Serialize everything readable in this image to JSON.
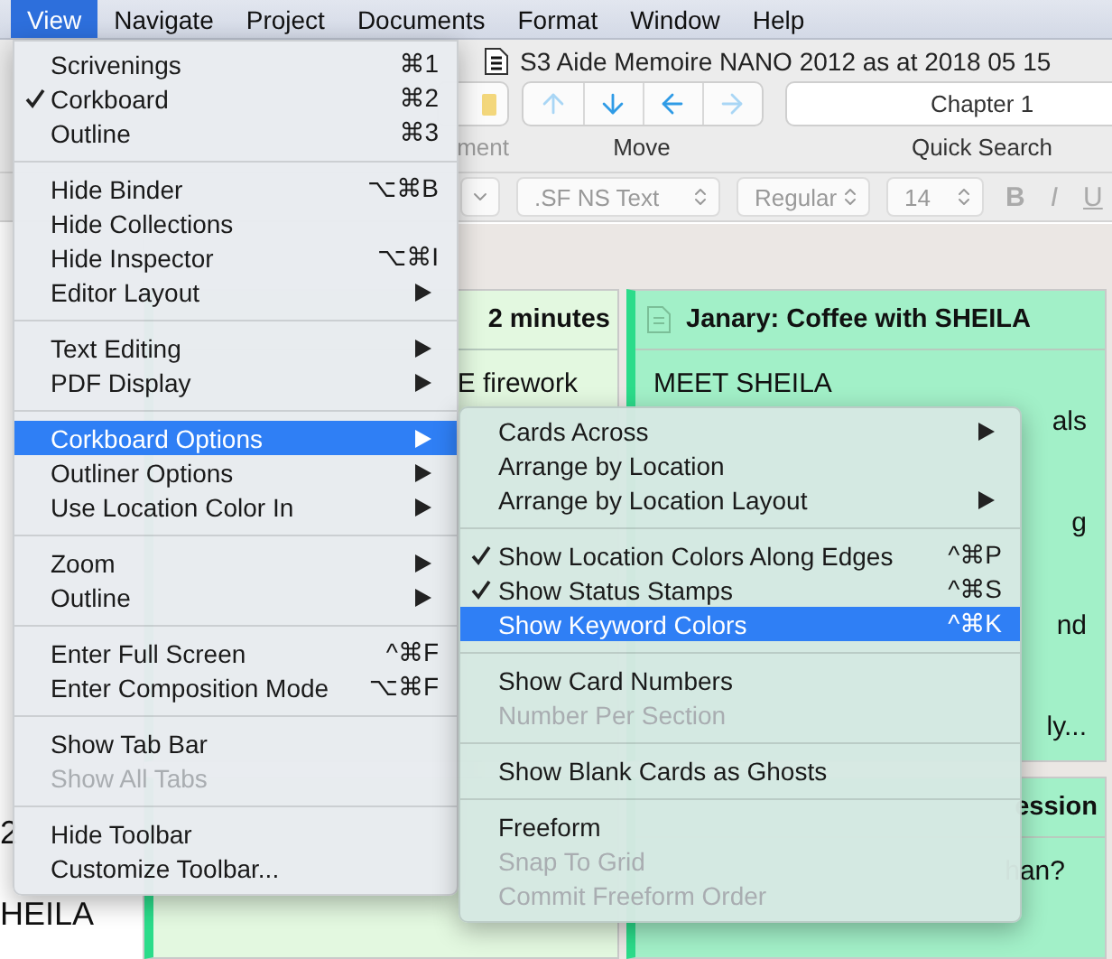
{
  "menubar": [
    {
      "label": "View",
      "selected": true
    },
    {
      "label": "Navigate",
      "selected": false
    },
    {
      "label": "Project",
      "selected": false
    },
    {
      "label": "Documents",
      "selected": false
    },
    {
      "label": "Format",
      "selected": false
    },
    {
      "label": "Window",
      "selected": false
    },
    {
      "label": "Help",
      "selected": false
    }
  ],
  "window": {
    "title": "S3 Aide Memoire NANO 2012 as at 2018 05 15"
  },
  "toolbar": {
    "cut_label": "ment",
    "nav_buttons": [
      {
        "kind": "up",
        "disabled": true
      },
      {
        "kind": "down",
        "disabled": false
      },
      {
        "kind": "left",
        "disabled": false
      },
      {
        "kind": "right",
        "disabled": true
      }
    ],
    "nav_label": "Move",
    "search_value": "Chapter 1",
    "search_label": "Quick Search"
  },
  "formatbar": {
    "font": ".SF NS Text",
    "style": "Regular",
    "size": "14",
    "buttons": [
      "B",
      "I",
      "U"
    ]
  },
  "binder": [
    {
      "label": "2"
    },
    {
      "label": "HEILA"
    }
  ],
  "cards": [
    {
      "kind": "clipped",
      "title": "2 minutes",
      "lines": [
        "E firework"
      ],
      "color": "#e3f8e0"
    },
    {
      "kind": "full",
      "title": "Janary: Coffee with SHEILA",
      "lines": [
        "MEET SHEILA"
      ],
      "tails": [
        "als",
        "g",
        "nd",
        "ly..."
      ],
      "color": "#a2f0c8"
    },
    {
      "kind": "clipped",
      "color": "#e3f8e0"
    },
    {
      "kind": "clipped",
      "title": "ession",
      "tails": [
        "han?"
      ],
      "color": "#a2f0c8"
    }
  ],
  "view_menu": [
    [
      {
        "label": "Scrivenings",
        "shortcut": "⌘1",
        "checked": false,
        "disabled": false,
        "submenu": false,
        "selected": false
      },
      {
        "label": "Corkboard",
        "shortcut": "⌘2",
        "checked": true,
        "disabled": false,
        "submenu": false,
        "selected": false
      },
      {
        "label": "Outline",
        "shortcut": "⌘3",
        "checked": false,
        "disabled": false,
        "submenu": false,
        "selected": false
      }
    ],
    [
      {
        "label": "Hide Binder",
        "shortcut": "⌥⌘B",
        "checked": false,
        "disabled": false,
        "submenu": false,
        "selected": false
      },
      {
        "label": "Hide Collections",
        "checked": false,
        "disabled": false,
        "submenu": false,
        "selected": false
      },
      {
        "label": "Hide Inspector",
        "shortcut": "⌥⌘I",
        "checked": false,
        "disabled": false,
        "submenu": false,
        "selected": false
      },
      {
        "label": "Editor Layout",
        "checked": false,
        "disabled": false,
        "submenu": true,
        "selected": false
      }
    ],
    [
      {
        "label": "Text Editing",
        "checked": false,
        "disabled": false,
        "submenu": true,
        "selected": false
      },
      {
        "label": "PDF Display",
        "checked": false,
        "disabled": false,
        "submenu": true,
        "selected": false
      }
    ],
    [
      {
        "label": "Corkboard Options",
        "checked": false,
        "disabled": false,
        "submenu": true,
        "selected": true
      },
      {
        "label": "Outliner Options",
        "checked": false,
        "disabled": false,
        "submenu": true,
        "selected": false
      },
      {
        "label": "Use Location Color In",
        "checked": false,
        "disabled": false,
        "submenu": true,
        "selected": false
      }
    ],
    [
      {
        "label": "Zoom",
        "checked": false,
        "disabled": false,
        "submenu": true,
        "selected": false
      },
      {
        "label": "Outline",
        "checked": false,
        "disabled": false,
        "submenu": true,
        "selected": false
      }
    ],
    [
      {
        "label": "Enter Full Screen",
        "shortcut": "^⌘F",
        "checked": false,
        "disabled": false,
        "submenu": false,
        "selected": false
      },
      {
        "label": "Enter Composition Mode",
        "shortcut": "⌥⌘F",
        "checked": false,
        "disabled": false,
        "submenu": false,
        "selected": false
      }
    ],
    [
      {
        "label": "Show Tab Bar",
        "checked": false,
        "disabled": false,
        "submenu": false,
        "selected": false
      },
      {
        "label": "Show All Tabs",
        "checked": false,
        "disabled": true,
        "submenu": false,
        "selected": false
      }
    ],
    [
      {
        "label": "Hide Toolbar",
        "checked": false,
        "disabled": false,
        "submenu": false,
        "selected": false
      },
      {
        "label": "Customize Toolbar...",
        "checked": false,
        "disabled": false,
        "submenu": false,
        "selected": false
      }
    ]
  ],
  "corkboard_submenu": [
    [
      {
        "label": "Cards Across",
        "checked": false,
        "disabled": false,
        "submenu": true,
        "selected": false
      },
      {
        "label": "Arrange by Location",
        "checked": false,
        "disabled": false,
        "submenu": false,
        "selected": false
      },
      {
        "label": "Arrange by Location Layout",
        "checked": false,
        "disabled": false,
        "submenu": true,
        "selected": false
      }
    ],
    [
      {
        "label": "Show Location Colors Along Edges",
        "shortcut": "^⌘P",
        "checked": true,
        "disabled": false,
        "submenu": false,
        "selected": false
      },
      {
        "label": "Show Status Stamps",
        "shortcut": "^⌘S",
        "checked": true,
        "disabled": false,
        "submenu": false,
        "selected": false
      },
      {
        "label": "Show Keyword Colors",
        "shortcut": "^⌘K",
        "checked": false,
        "disabled": false,
        "submenu": false,
        "selected": true
      }
    ],
    [
      {
        "label": "Show Card Numbers",
        "checked": false,
        "disabled": false,
        "submenu": false,
        "selected": false
      },
      {
        "label": "Number Per Section",
        "checked": false,
        "disabled": true,
        "submenu": false,
        "selected": false
      }
    ],
    [
      {
        "label": "Show Blank Cards as Ghosts",
        "checked": false,
        "disabled": false,
        "submenu": false,
        "selected": false
      }
    ],
    [
      {
        "label": "Freeform",
        "checked": false,
        "disabled": false,
        "submenu": false,
        "selected": false
      },
      {
        "label": "Snap To Grid",
        "checked": false,
        "disabled": true,
        "submenu": false,
        "selected": false
      },
      {
        "label": "Commit Freeform Order",
        "checked": false,
        "disabled": true,
        "submenu": false,
        "selected": false
      }
    ]
  ]
}
